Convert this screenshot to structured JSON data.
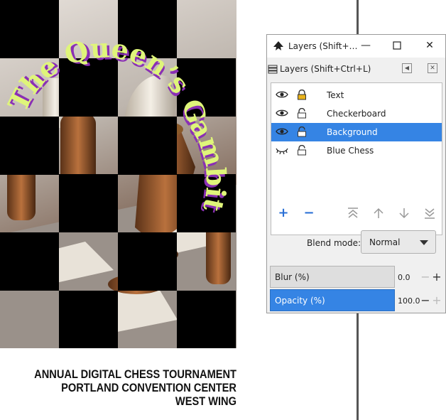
{
  "poster": {
    "title": "The Queen’s Gambit",
    "line1": "ANNUAL DIGITAL CHESS TOURNAMENT",
    "line2": "PORTLAND CONVENTION CENTER",
    "line3": "WEST WING",
    "title_color": "#dff57a",
    "title_shadow": "#8a2fb5"
  },
  "dialog": {
    "window_title": "Layers (Shift+…",
    "tab_label": "Layers (Shift+Ctrl+L)",
    "layers": [
      {
        "name": "Text",
        "visible": true,
        "locked": true,
        "selected": false
      },
      {
        "name": "Checkerboard",
        "visible": true,
        "locked": false,
        "selected": false
      },
      {
        "name": "Background",
        "visible": true,
        "locked": false,
        "selected": true
      },
      {
        "name": "Blue Chess",
        "visible": false,
        "locked": false,
        "selected": false
      }
    ],
    "blend_label": "Blend mode:",
    "blend_value": "Normal",
    "blur_label": "Blur (%)",
    "blur_value": "0.0",
    "opacity_label": "Opacity (%)",
    "opacity_value": "100.0",
    "accent_color": "#3584e4"
  }
}
